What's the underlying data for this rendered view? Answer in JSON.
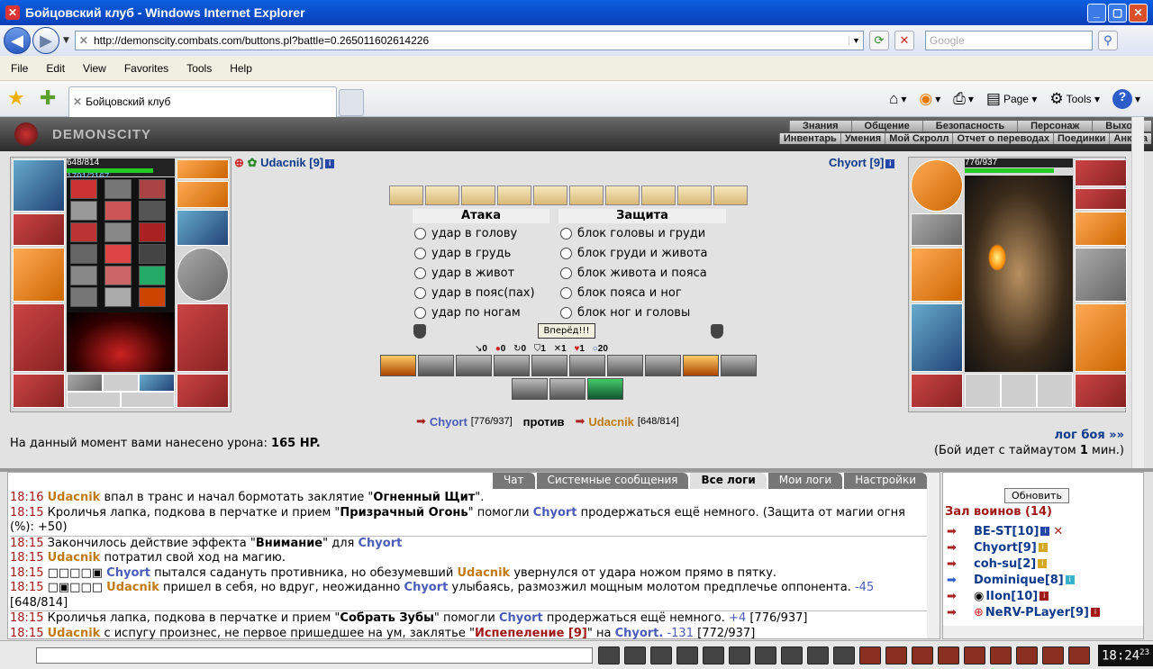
{
  "window": {
    "title": "Бойцовский клуб - Windows Internet Explorer"
  },
  "address": {
    "url": "http://demonscity.combats.com/buttons.pl?battle=0.265011602614226",
    "search_placeholder": "Google"
  },
  "menu": [
    "File",
    "Edit",
    "View",
    "Favorites",
    "Tools",
    "Help"
  ],
  "tab": {
    "title": "Бойцовский клуб"
  },
  "commands": {
    "page": "Page",
    "tools": "Tools"
  },
  "game": {
    "logo": "DEMONSCITY",
    "top_links": [
      "Знания",
      "Общение",
      "Безопасность",
      "Персонаж",
      "Выход"
    ],
    "bottom_links": [
      "Инвентарь",
      "Умения",
      "Мой Скролл",
      "Отчет о переводах",
      "Поединки",
      "Анкета"
    ]
  },
  "left_player": {
    "name": "Udacnik [9]",
    "hp": "648/814",
    "mana": "1791/2167",
    "hp_fraction": 0.796,
    "mana_fraction": 0.826
  },
  "right_player": {
    "name": "Chyort [9]",
    "hp": "776/937",
    "hp_fraction": 0.828
  },
  "combat": {
    "attack_title": "Атака",
    "defense_title": "Защита",
    "attacks": [
      "удар в голову",
      "удар в грудь",
      "удар в живот",
      "удар в пояс(пах)",
      "удар по ногам"
    ],
    "defenses": [
      "блок головы и груди",
      "блок груди и живота",
      "блок живота и пояса",
      "блок пояса и ног",
      "блок ног и головы"
    ],
    "forward": "Вперёд!!!",
    "stats": [
      "0",
      "0",
      "0",
      "1",
      "1",
      "1",
      "20"
    ]
  },
  "versus": {
    "p1": "Chyort",
    "p1_hp": "[776/937]",
    "mid": "против",
    "p2": "Udacnik",
    "p2_hp": "[648/814]"
  },
  "damage": {
    "text": "На данный момент вами нанесено урона:",
    "value": "165 HP."
  },
  "log_link": "лог боя »»",
  "timer": {
    "pre": "(Бой идет с таймаутом",
    "value": "1",
    "post": "мин.)"
  },
  "chat_tabs": [
    "Чат",
    "Системные сообщения",
    "Все логи",
    "Мои логи",
    "Настройки"
  ],
  "logs": [
    {
      "time": "18:16",
      "a": "Udacnik",
      "b": "впал в транс и начал бормотать заклятие \"",
      "c": "Огненный Щит",
      "d": "\"."
    },
    {
      "time": "18:15",
      "b": "Кроличья лапка, подкова в перчатке и прием \"",
      "c": "Призрачный Огонь",
      "d": "\" помогли",
      "e": "Chyort",
      "f": "продержаться ещё немного. (Защита от магии огня (%): +50)"
    },
    {
      "time": "18:15",
      "b": "Закончилось действие эффекта \"",
      "c": "Внимание",
      "d": "\" для",
      "e": "Chyort"
    },
    {
      "time": "18:15",
      "a": "Udacnik",
      "b": "потратил свой ход на магию."
    },
    {
      "time": "18:15",
      "sq": "□□□□▣",
      "e": "Chyort",
      "b": "пытался садануть противника, но обезумевший",
      "a": "Udacnik",
      "f": "увернулся от удара ножом прямо в пятку."
    },
    {
      "time": "18:15",
      "sq": "□▣□□□",
      "a": "Udacnik",
      "b": "пришел в себя, но вдруг, неожиданно",
      "e": "Chyort",
      "f": "улыбаясь, размозжил мощным молотом предплечье оппонента.",
      "g": "-45",
      "h": "[648/814]"
    },
    {
      "time": "18:15",
      "b": "Кроличья лапка, подкова в перчатке и прием \"",
      "c": "Собрать Зубы",
      "d": "\" помогли",
      "e": "Chyort",
      "f": "продержаться ещё немного.",
      "g": "+4",
      "h": "[776/937]"
    },
    {
      "time": "18:15",
      "a": "Udacnik",
      "b": "с испугу произнес, не первое пришедшее на ум, заклятье \"",
      "r": "Испепеление [9]",
      "d": "\" на",
      "e": "Chyort.",
      "g": "-131",
      "h": "[772/937]"
    }
  ],
  "sidebar": {
    "refresh": "Обновить",
    "hall": "Зал воинов (14)",
    "warriors": [
      "BE-ST[10]",
      "Chyort[9]",
      "coh-su[2]",
      "Dominique[8]",
      "IIon[10]",
      "NeRV-PLayer[9]"
    ]
  },
  "clock": {
    "time": "18:24",
    "sec": "23"
  }
}
